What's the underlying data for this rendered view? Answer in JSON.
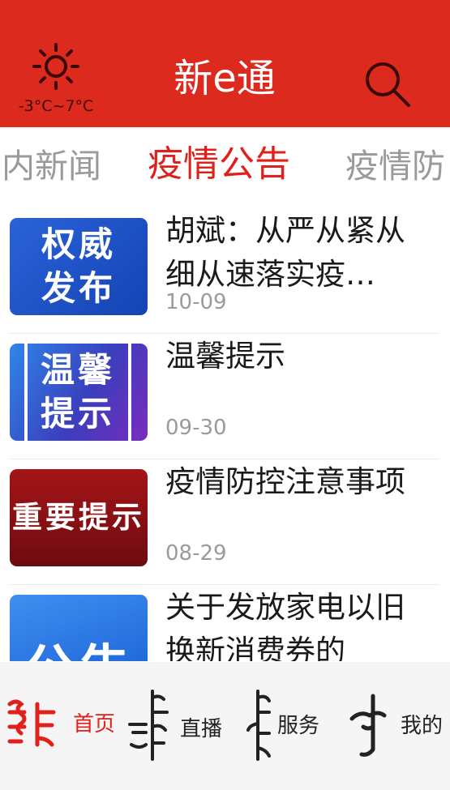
{
  "header": {
    "weather_icon": "sun-icon",
    "temperature": "-3°C~7°C",
    "title": "新e通",
    "search_icon": "search-icon",
    "background_color": "#dd2a1f"
  },
  "tabs": [
    {
      "label": "内新闻",
      "active": false
    },
    {
      "label": "疫情公告",
      "active": true
    },
    {
      "label": "疫情防",
      "active": false
    }
  ],
  "news": [
    {
      "thumb_text": "权威发布",
      "title": "胡斌：从严从紧从细从速落实疫…",
      "date": "10-09"
    },
    {
      "thumb_text": "温馨提示",
      "title": "温馨提示",
      "date": "09-30"
    },
    {
      "thumb_text": "重要提示",
      "title": "疫情防控注意事项",
      "date": "08-29"
    },
    {
      "thumb_text": "公告",
      "title": "关于发放家电以旧换新消费券的",
      "date": ""
    }
  ],
  "nav": [
    {
      "label": "首页",
      "icon": "mongolian-script-icon",
      "active": true
    },
    {
      "label": "直播",
      "icon": "mongolian-script-icon",
      "active": false
    },
    {
      "label": "服务",
      "icon": "mongolian-script-icon",
      "active": false
    },
    {
      "label": "我的",
      "icon": "mongolian-script-icon",
      "active": false
    }
  ],
  "colors": {
    "accent": "#e0201b",
    "header": "#dd2a1f",
    "inactive_text": "#9a9a9a"
  }
}
